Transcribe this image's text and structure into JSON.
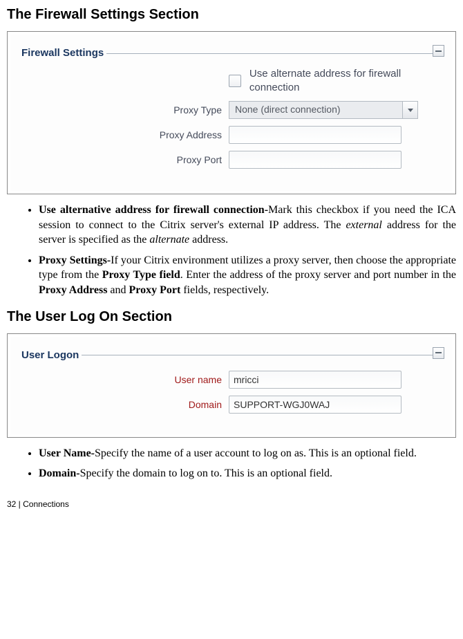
{
  "section1_title": "The Firewall Settings Section",
  "panel1": {
    "legend": "Firewall Settings",
    "alt_address_label": "Use alternate address for firewall connection",
    "proxy_type_label": "Proxy Type",
    "proxy_type_value": "None (direct connection)",
    "proxy_address_label": "Proxy Address",
    "proxy_address_value": "",
    "proxy_port_label": "Proxy Port",
    "proxy_port_value": ""
  },
  "bullets1": {
    "b1_lead": "Use alternative address for firewall connection-",
    "b1_text1": "Mark this checkbox if you need the ICA session to connect to the Citrix server's external IP address.  The ",
    "b1_em1": "external",
    "b1_text2": " address for the server is specified as the ",
    "b1_em2": "alternate",
    "b1_text3": " address.",
    "b2_lead": "Proxy Settings-",
    "b2_text1": "If your Citrix environment utilizes a proxy server, then choose the appropriate type from the ",
    "b2_bold1": "Proxy Type field",
    "b2_text2": ".  Enter the address of the proxy server and port number in the ",
    "b2_bold2": "Proxy Address",
    "b2_text3": " and ",
    "b2_bold3": "Proxy Port",
    "b2_text4": " fields, respectively."
  },
  "section2_title": "The User Log On Section",
  "panel2": {
    "legend": "User Logon",
    "username_label": "User name",
    "username_value": "mricci",
    "domain_label": "Domain",
    "domain_value": "SUPPORT-WGJ0WAJ"
  },
  "bullets2": {
    "b1_lead": "User Name-",
    "b1_text": "Specify the name of a user account to log on as.  This is an optional field.",
    "b2_lead": "Domain-",
    "b2_text": "Specify the domain to log on to.  This is an optional field."
  },
  "footer": "32 | Connections"
}
